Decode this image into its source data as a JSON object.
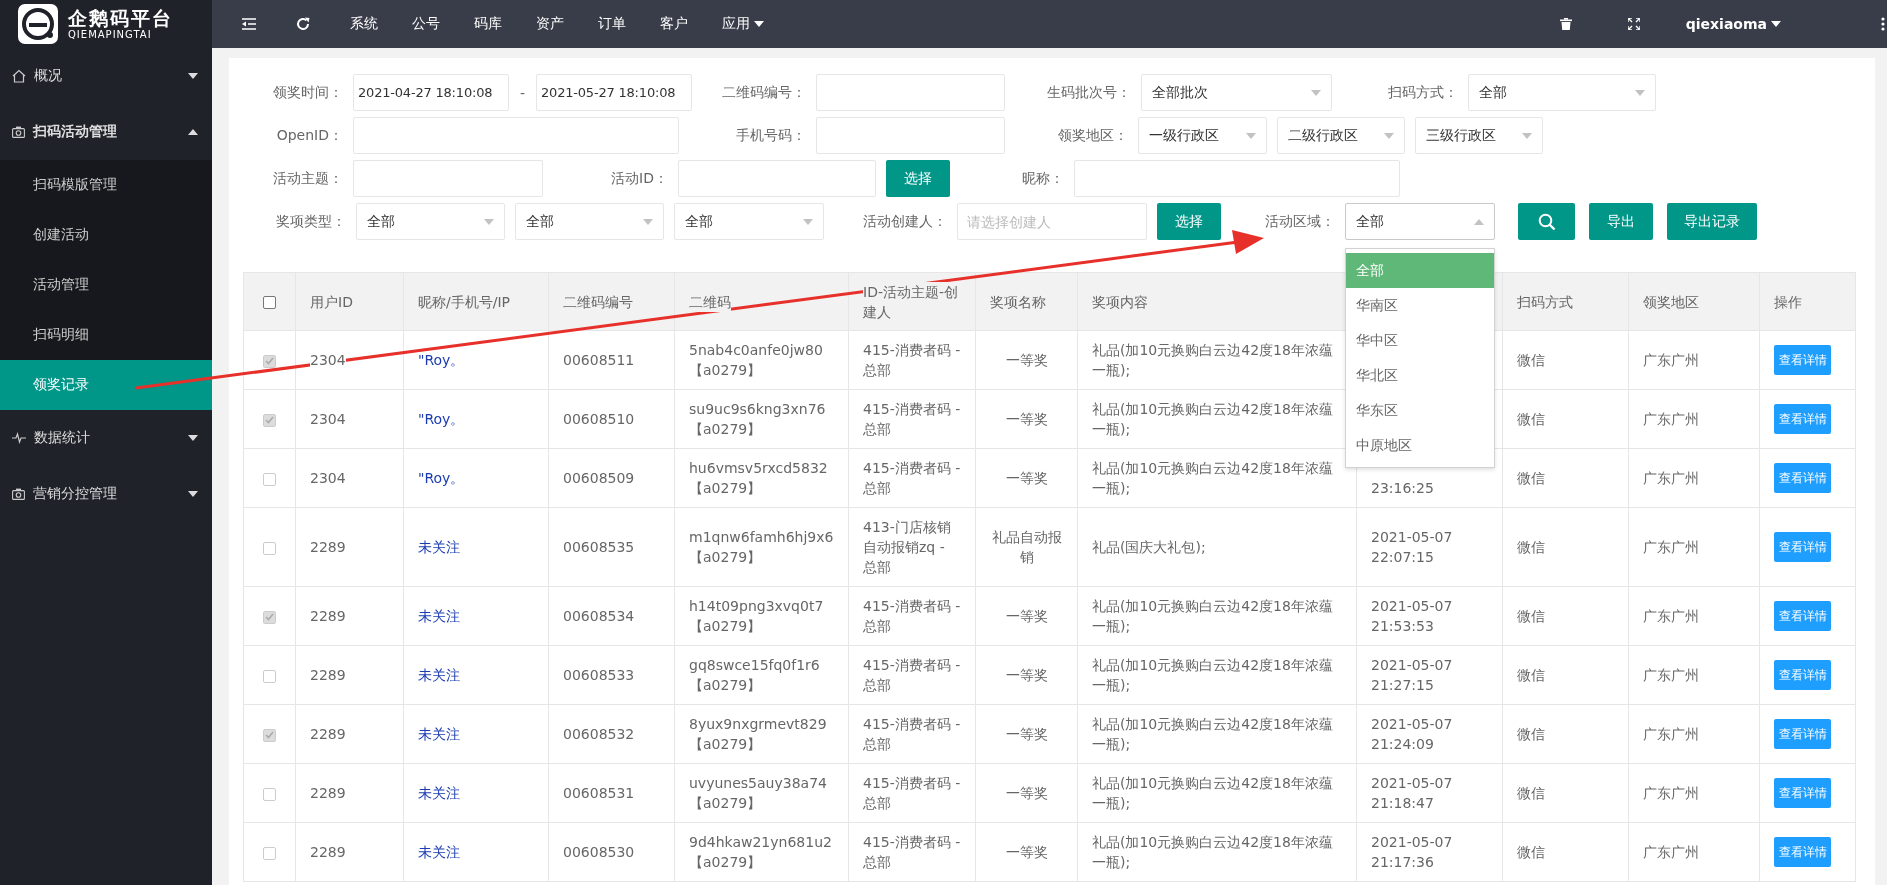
{
  "logo": {
    "title": "企鹅码平台",
    "subtitle": "QIEMAPINGTAI"
  },
  "menu": [
    {
      "label": "概况",
      "expanded": false
    },
    {
      "label": "扫码活动管理",
      "expanded": true,
      "children": [
        {
          "label": "扫码模版管理",
          "selected": false
        },
        {
          "label": "创建活动",
          "selected": false
        },
        {
          "label": "活动管理",
          "selected": false
        },
        {
          "label": "扫码明细",
          "selected": false
        },
        {
          "label": "领奖记录",
          "selected": true
        }
      ]
    },
    {
      "label": "数据统计",
      "expanded": false
    },
    {
      "label": "营销分控管理",
      "expanded": false
    }
  ],
  "nav": [
    {
      "label": "系统",
      "dropdown": false
    },
    {
      "label": "公号",
      "dropdown": false
    },
    {
      "label": "码库",
      "dropdown": false
    },
    {
      "label": "资产",
      "dropdown": false
    },
    {
      "label": "订单",
      "dropdown": false
    },
    {
      "label": "客户",
      "dropdown": false
    },
    {
      "label": "应用",
      "dropdown": true
    }
  ],
  "user": {
    "name": "qiexiaoma"
  },
  "filters": [
    {
      "fields": [
        {
          "label": "领奖时间：",
          "kind": "date_range",
          "from": "2021-04-27 18:10:08",
          "separator": "-",
          "to": "2021-05-27 18:10:08"
        },
        {
          "label": "二维码编号：",
          "kind": "input"
        },
        {
          "label": "生码批次号：",
          "kind": "select",
          "value": "全部批次"
        },
        {
          "label": "扫码方式：",
          "kind": "select",
          "value": "全部"
        }
      ]
    },
    {
      "fields": [
        {
          "label": "OpenID：",
          "kind": "input"
        },
        {
          "label": "手机号码：",
          "kind": "input"
        },
        {
          "label": "领奖地区：",
          "kind": "selects",
          "values": [
            "一级行政区",
            "二级行政区",
            "三级行政区"
          ]
        }
      ]
    },
    {
      "fields": [
        {
          "label": "活动主题：",
          "kind": "input"
        },
        {
          "label": "活动ID：",
          "kind": "input_button",
          "button": "选择"
        },
        {
          "label": "昵称：",
          "kind": "input"
        }
      ]
    },
    {
      "fields": [
        {
          "label": "奖项类型：",
          "kind": "selects",
          "values": [
            "全部",
            "全部",
            "全部"
          ]
        },
        {
          "label": "活动创建人：",
          "kind": "input_button",
          "placeholder": "请选择创建人",
          "button": "选择"
        },
        {
          "label": "活动区域：",
          "kind": "select",
          "value": "全部",
          "open": true,
          "options": [
            {
              "label": "全部",
              "selected": true
            },
            {
              "label": "华南区",
              "selected": false
            },
            {
              "label": "华中区",
              "selected": false
            },
            {
              "label": "华北区",
              "selected": false
            },
            {
              "label": "华东区",
              "selected": false
            },
            {
              "label": "中原地区",
              "selected": false
            }
          ]
        }
      ]
    }
  ],
  "actions": [
    {
      "kind": "search"
    },
    {
      "kind": "text",
      "label": "导出"
    },
    {
      "kind": "text",
      "label": "导出记录"
    }
  ],
  "table": {
    "header_checked": false,
    "columns": [
      {
        "label": "用户ID"
      },
      {
        "label": "昵称/手机号/IP"
      },
      {
        "label": "二维码编号"
      },
      {
        "label": "二维码"
      },
      {
        "label": "ID-活动主题-创建人"
      },
      {
        "label": "奖项名称"
      },
      {
        "label": "奖项内容"
      },
      {},
      {
        "label": "扫码方式"
      },
      {
        "label": "领奖地区"
      },
      {
        "label": "操作"
      }
    ],
    "rows": [
      {
        "checked": true,
        "user_id": "2304",
        "nickname": "\"Roy。",
        "qr_no": "00608511",
        "qr_code": [
          "5nab4c0anfe0jw80",
          "【a0279】"
        ],
        "activity": [
          "415-消费者码 -",
          "总部"
        ],
        "prize_name": [
          "一等奖"
        ],
        "prize_content": [
          "礼品(加10元换购白云边42度18年浓蕴",
          "一瓶);"
        ],
        "scan_method": "微信",
        "region": "广东广州",
        "action": "查看详情"
      },
      {
        "checked": true,
        "user_id": "2304",
        "nickname": "\"Roy。",
        "qr_no": "00608510",
        "qr_code": [
          "su9uc9s6kng3xn76",
          "【a0279】"
        ],
        "activity": [
          "415-消费者码 -",
          "总部"
        ],
        "prize_name": [
          "一等奖"
        ],
        "prize_content": [
          "礼品(加10元换购白云边42度18年浓蕴",
          "一瓶);"
        ],
        "scan_method": "微信",
        "region": "广东广州",
        "action": "查看详情"
      },
      {
        "checked": false,
        "user_id": "2304",
        "nickname": "\"Roy。",
        "qr_no": "00608509",
        "qr_code": [
          "hu6vmsv5rxcd5832",
          "【a0279】"
        ],
        "activity": [
          "415-消费者码 -",
          "总部"
        ],
        "prize_name": [
          "一等奖"
        ],
        "prize_content": [
          "礼品(加10元换购白云边42度18年浓蕴",
          "一瓶);"
        ],
        "time": [
          "23:16:25"
        ],
        "scan_method": "微信",
        "region": "广东广州",
        "action": "查看详情"
      },
      {
        "checked": false,
        "user_id": "2289",
        "nickname": "未关注",
        "qr_no": "00608535",
        "qr_code": [
          "m1qnw6famh6hj9x6",
          "【a0279】"
        ],
        "activity": [
          "413-门店核销",
          "自动报销zq -",
          "总部"
        ],
        "prize_name": [
          "礼品自动报",
          "销"
        ],
        "prize_content": [
          "礼品(国庆大礼包);"
        ],
        "time": [
          "2021-05-07",
          "22:07:15"
        ],
        "scan_method": "微信",
        "region": "广东广州",
        "action": "查看详情"
      },
      {
        "checked": true,
        "user_id": "2289",
        "nickname": "未关注",
        "qr_no": "00608534",
        "qr_code": [
          "h14t09png3xvq0t7",
          "【a0279】"
        ],
        "activity": [
          "415-消费者码 -",
          "总部"
        ],
        "prize_name": [
          "一等奖"
        ],
        "prize_content": [
          "礼品(加10元换购白云边42度18年浓蕴",
          "一瓶);"
        ],
        "time": [
          "2021-05-07",
          "21:53:53"
        ],
        "scan_method": "微信",
        "region": "广东广州",
        "action": "查看详情"
      },
      {
        "checked": false,
        "user_id": "2289",
        "nickname": "未关注",
        "qr_no": "00608533",
        "qr_code": [
          "gq8swce15fq0f1r6",
          "【a0279】"
        ],
        "activity": [
          "415-消费者码 -",
          "总部"
        ],
        "prize_name": [
          "一等奖"
        ],
        "prize_content": [
          "礼品(加10元换购白云边42度18年浓蕴",
          "一瓶);"
        ],
        "time": [
          "2021-05-07",
          "21:27:15"
        ],
        "scan_method": "微信",
        "region": "广东广州",
        "action": "查看详情"
      },
      {
        "checked": true,
        "user_id": "2289",
        "nickname": "未关注",
        "qr_no": "00608532",
        "qr_code": [
          "8yux9nxgrmevt829",
          "【a0279】"
        ],
        "activity": [
          "415-消费者码 -",
          "总部"
        ],
        "prize_name": [
          "一等奖"
        ],
        "prize_content": [
          "礼品(加10元换购白云边42度18年浓蕴",
          "一瓶);"
        ],
        "time": [
          "2021-05-07",
          "21:24:09"
        ],
        "scan_method": "微信",
        "region": "广东广州",
        "action": "查看详情"
      },
      {
        "checked": false,
        "user_id": "2289",
        "nickname": "未关注",
        "qr_no": "00608531",
        "qr_code": [
          "uvyunes5auy38a74",
          "【a0279】"
        ],
        "activity": [
          "415-消费者码 -",
          "总部"
        ],
        "prize_name": [
          "一等奖"
        ],
        "prize_content": [
          "礼品(加10元换购白云边42度18年浓蕴",
          "一瓶);"
        ],
        "time": [
          "2021-05-07",
          "21:18:47"
        ],
        "scan_method": "微信",
        "region": "广东广州",
        "action": "查看详情"
      },
      {
        "checked": false,
        "user_id": "2289",
        "nickname": "未关注",
        "qr_no": "00608530",
        "qr_code": [
          "9d4hkaw21yn681u2",
          "【a0279】"
        ],
        "activity": [
          "415-消费者码 -",
          "总部"
        ],
        "prize_name": [
          "一等奖"
        ],
        "prize_content": [
          "礼品(加10元换购白云边42度18年浓蕴",
          "一瓶);"
        ],
        "time": [
          "2021-05-07",
          "21:17:36"
        ],
        "scan_method": "微信",
        "region": "广东广州",
        "action": "查看详情"
      }
    ]
  }
}
